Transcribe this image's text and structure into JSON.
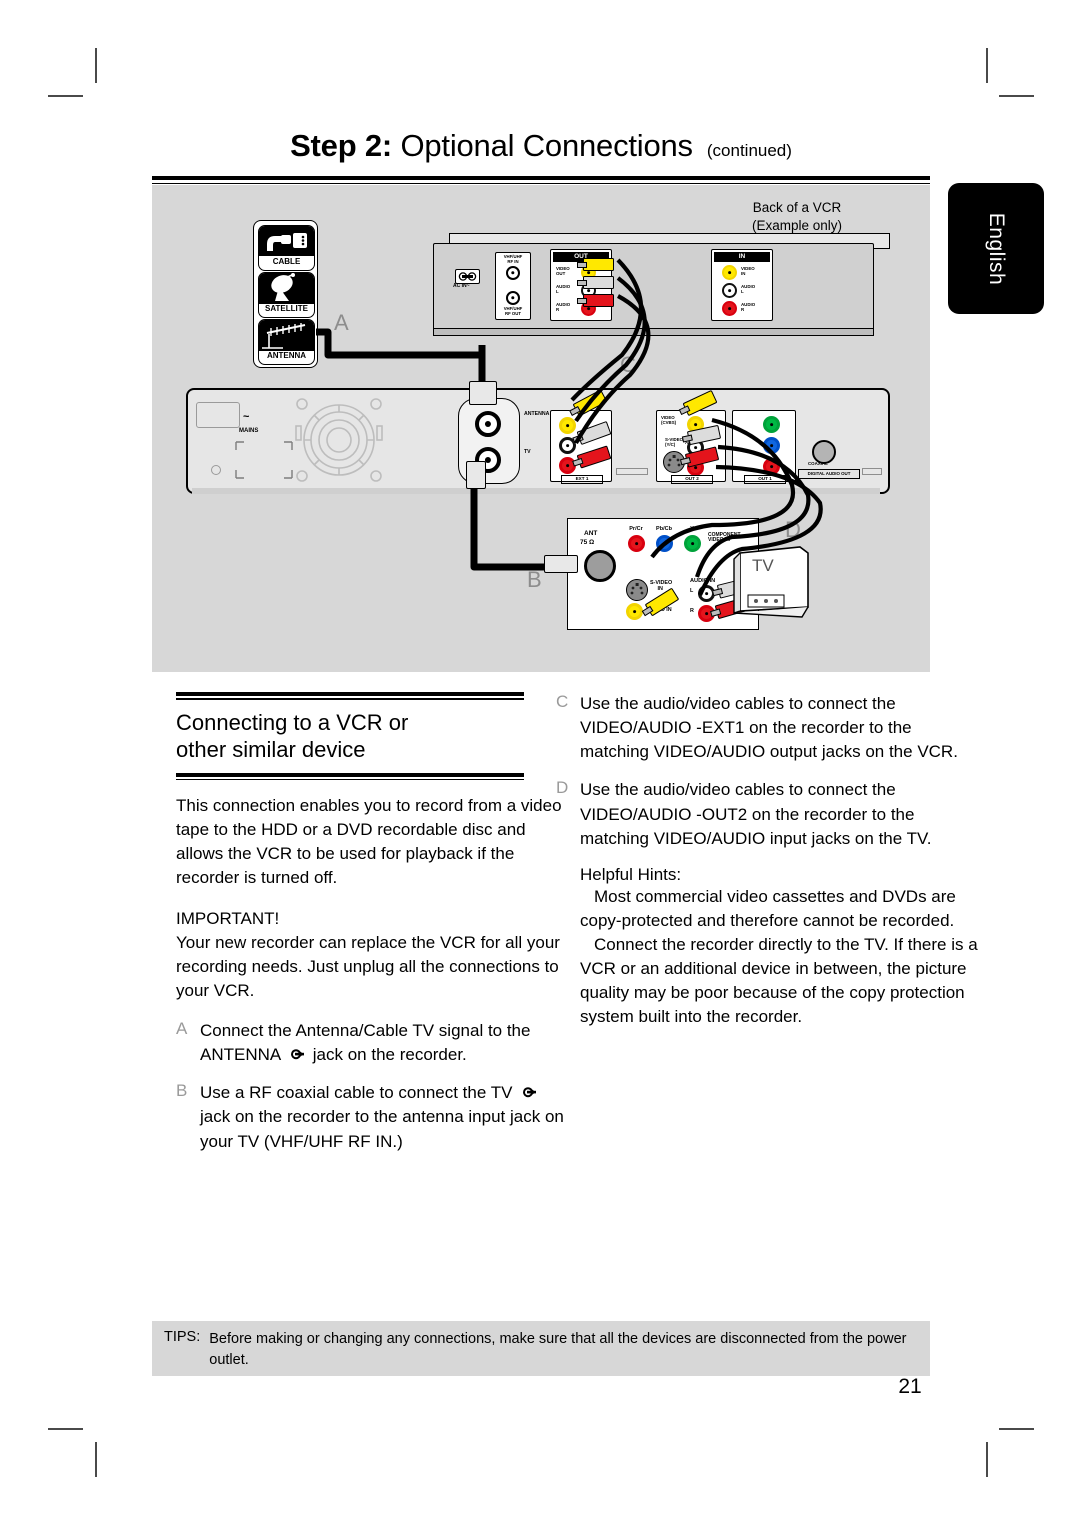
{
  "header": {
    "title_bold": "Step 2:",
    "title_rest": "Optional Connections",
    "continued": "(continued)"
  },
  "language_tab": {
    "label": "English"
  },
  "diagram": {
    "vcr_caption_line1": "Back of a VCR",
    "vcr_caption_line2": "(Example only)",
    "callouts": {
      "a": "A",
      "b": "B",
      "c": "C",
      "d": "D"
    },
    "source_icons": [
      {
        "name": "cable-icon",
        "label": "CABLE"
      },
      {
        "name": "satellite-icon",
        "label": "SATELLITE"
      },
      {
        "name": "antenna-icon",
        "label": "ANTENNA"
      }
    ],
    "vcr_panel": {
      "ac_in": "AC IN~",
      "rf_in": "VHF/UHF\nRF IN",
      "rf_out": "VHF/UHF\nRF OUT",
      "out_group": "OUT",
      "out_video": "VIDEO\nOUT",
      "out_audio_l": "AUDIO\nL",
      "out_audio_r": "AUDIO\nR",
      "in_group": "IN",
      "in_video": "VIDEO\nIN",
      "in_audio_l": "AUDIO\nL",
      "in_audio_r": "AUDIO\nR"
    },
    "recorder_panel": {
      "mains": "MAINS",
      "antenna": "ANTENNA",
      "tv": "TV",
      "ext1": "EXT 1",
      "out2": "OUT 2",
      "out1": "OUT 1",
      "audio": "AUDIO",
      "video_cvbs": "VIDEO\n(CVBS)",
      "s_video": "S-VIDEO\n(Y/C)",
      "coaxial": "COAXIAL",
      "digital_audio_out": "DIGITAL AUDIO OUT"
    },
    "tv_panel": {
      "ant": "ANT",
      "ant_ohm": "75 Ω",
      "pr_cr": "Pr/Cr",
      "pb_cb": "Pb/Cb",
      "y": "Y",
      "component_video_in": "COMPONENT\nVIDEO IN",
      "s_video_in": "S-VIDEO\nIN",
      "video_in": "VIDEO IN",
      "audio_in": "AUDIO IN",
      "audio_l": "L",
      "audio_r": "R",
      "tv_set": "TV"
    }
  },
  "content": {
    "section_title_line1": "Connecting to a VCR or",
    "section_title_line2": "other similar device",
    "intro": "This connection enables you to record from a video tape to the HDD or a DVD recordable disc and allows the VCR to be used for playback if the recorder is turned off.",
    "important_label": "IMPORTANT!",
    "important_text": "Your new recorder can replace the VCR for all your recording needs. Just unplug all the connections to your VCR.",
    "steps": [
      {
        "marker": "A",
        "text_before": "Connect the Antenna/Cable TV signal to the ANTENNA ",
        "glyph": "antenna-in-glyph",
        "text_after": " jack on the recorder."
      },
      {
        "marker": "B",
        "text_before": "Use a RF coaxial cable to connect the TV ",
        "glyph": "antenna-out-glyph",
        "text_after": " jack on the recorder to the antenna input jack on your TV (VHF/UHF RF IN.)"
      },
      {
        "marker": "C",
        "text_before": "Use the audio/video cables to connect the VIDEO/AUDIO -EXT1 ",
        "glyph": "",
        "text_after": " on the recorder to the matching VIDEO/AUDIO output jacks on the VCR."
      },
      {
        "marker": "D",
        "text_before": "Use the audio/video cables to connect the VIDEO/AUDIO -OUT2 ",
        "glyph": "",
        "text_after": " on the recorder to the matching VIDEO/AUDIO input jacks on the TV."
      }
    ],
    "hints_title": "Helpful Hints:",
    "hint_1": "Most commercial video cassettes and DVDs are copy-protected and therefore cannot be recorded.",
    "hint_2": "Connect the recorder directly to the TV. If there is a VCR or an additional device in between, the picture quality may be poor because of the copy protection system built into the recorder."
  },
  "footer": {
    "tips_label": "TIPS:",
    "tips_text": "Before making or changing any connections, make sure that all the devices are disconnected from the power outlet.",
    "page_number": "21"
  },
  "colors": {
    "panel_gray": "#d7d7d7",
    "callout_gray": "#8d8d8d",
    "yellow": "#ffe800",
    "red": "#e4141c",
    "green": "#00b844",
    "blue": "#1066e0",
    "black": "#000000"
  }
}
